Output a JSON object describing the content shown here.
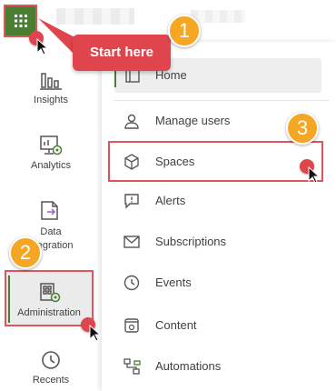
{
  "nav": {
    "insights": "Insights",
    "analytics": "Analytics",
    "data_integration": "Data\nntegration",
    "administration": "Administration",
    "recents": "Recents"
  },
  "menu": {
    "home": "Home",
    "manage_users": "Manage users",
    "spaces": "Spaces",
    "alerts": "Alerts",
    "subscriptions": "Subscriptions",
    "events": "Events",
    "content": "Content",
    "automations": "Automations"
  },
  "callouts": {
    "start_here": "Start here",
    "step1": "1",
    "step2": "2",
    "step3": "3"
  },
  "colors": {
    "brand_green": "#4b7d32",
    "highlight_red": "#e0555c",
    "badge_orange": "#f5a623"
  },
  "icons": {
    "launcher": "grid-icon",
    "insights": "insights-chart-icon",
    "analytics": "analytics-monitor-icon",
    "data_integration": "data-integration-icon",
    "administration": "administration-building-gear-icon",
    "recents": "clock-icon",
    "home": "home-icon",
    "manage_users": "user-icon",
    "spaces": "cube-icon",
    "alerts": "alert-bubble-icon",
    "subscriptions": "envelope-icon",
    "events": "clock-icon",
    "content": "content-icon",
    "automations": "automation-icon"
  }
}
